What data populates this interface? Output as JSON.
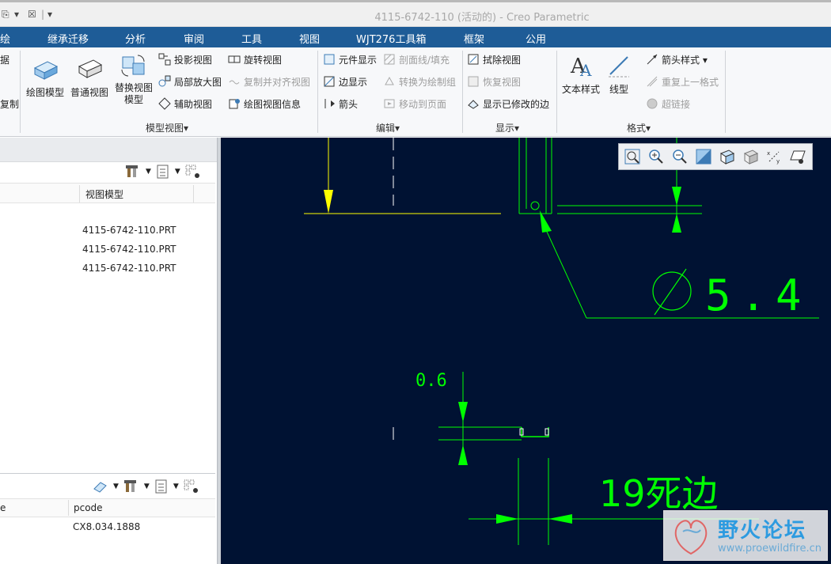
{
  "window": {
    "title": "4115-6742-110 (活动的) - Creo Parametric",
    "quick_access": [
      "⎘",
      "▾",
      "☒",
      "▾"
    ]
  },
  "menu": [
    "绘",
    "继承迁移",
    "分析",
    "审阅",
    "工具",
    "视图",
    "WJT276工具箱",
    "框架",
    "公用"
  ],
  "ribbon": {
    "partial": {
      "a": "据",
      "b": "复制"
    },
    "model_view": {
      "label": "模型视图▾",
      "big": [
        "绘图模型",
        "普通视图",
        "替换视图\n模型"
      ],
      "small": [
        "投影视图",
        "局部放大图",
        "辅助视图",
        "旋转视图",
        "复制并对齐视图",
        "绘图视图信息"
      ]
    },
    "edit": {
      "label": "编辑▾",
      "small": [
        "元件显示",
        "边显示",
        "箭头",
        "剖面线/填充",
        "转换为绘制组",
        "移动到页面"
      ]
    },
    "display": {
      "label": "显示▾",
      "small": [
        "拭除视图",
        "恢复视图",
        "显示已修改的边"
      ]
    },
    "format": {
      "label": "格式▾",
      "big": [
        "文本样式",
        "线型"
      ],
      "small": [
        "箭头样式 ▾",
        "重复上一格式",
        "超链接"
      ]
    }
  },
  "top_panel": {
    "column": "视图模型",
    "rows": [
      "4115-6742-110.PRT",
      "4115-6742-110.PRT",
      "4115-6742-110.PRT"
    ]
  },
  "bottom_panel": {
    "col_a": "e",
    "col_b": "pcode",
    "row": "CX8.034.1888"
  },
  "drawing": {
    "dim_diameter": "Ø5.4",
    "dim_small": "0.6",
    "note": "19死边",
    "colors": {
      "bg": "#001233",
      "yellow": "#ffff00",
      "green": "#00ff00",
      "white": "#ffffff"
    }
  },
  "watermark": {
    "cn": "野火论坛",
    "url": "www.proewildfire.cn"
  }
}
